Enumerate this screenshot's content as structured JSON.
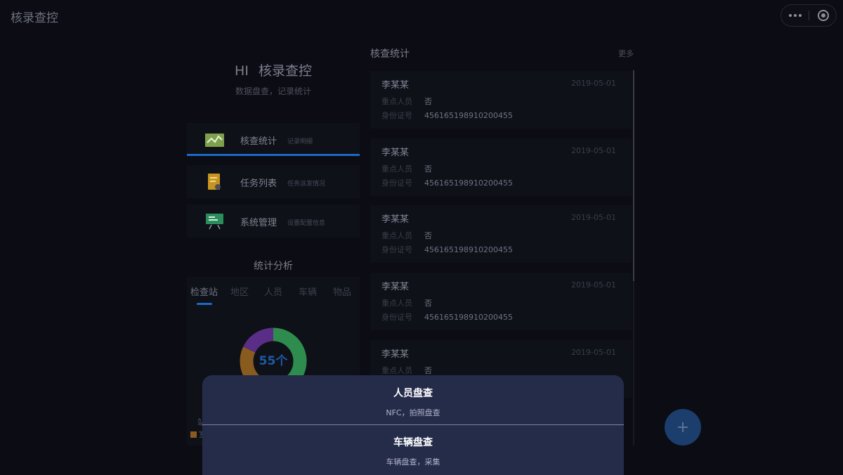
{
  "header": {
    "title": "核录查控"
  },
  "greeting": {
    "hi": "HI",
    "name": "核录查控",
    "subtitle": "数据盘查，记录统计"
  },
  "menu": [
    {
      "label": "核查统计",
      "desc": "记录明细",
      "icon": "chart-icon",
      "color": "#7ea04d"
    },
    {
      "label": "任务列表",
      "desc": "任务派发情况",
      "icon": "task-icon",
      "color": "#c7951f"
    },
    {
      "label": "系统管理",
      "desc": "设置配置信息",
      "icon": "board-icon",
      "color": "#2b8c5c"
    }
  ],
  "stats": {
    "title": "统计分析",
    "tabs": [
      "检查站",
      "地区",
      "人员",
      "车辆",
      "物品"
    ],
    "center_label": "55个",
    "legend_title": "站",
    "legend_first": "室"
  },
  "chart_data": {
    "type": "pie",
    "total_label": "55个",
    "slices": [
      {
        "color": "#2e8c4e",
        "fraction": 0.38
      },
      {
        "color": "#1b5aa8",
        "fraction": 0.1
      },
      {
        "color": "#8a5b1e",
        "fraction": 0.34
      },
      {
        "color": "#5a2d86",
        "fraction": 0.18
      }
    ]
  },
  "records": {
    "title": "核查统计",
    "more": "更多",
    "key_person_label": "重点人员",
    "id_label": "身份证号",
    "items": [
      {
        "name": "李某某",
        "date": "2019-05-01",
        "key_person": "否",
        "id_number": "456165198910200455"
      },
      {
        "name": "李某某",
        "date": "2019-05-01",
        "key_person": "否",
        "id_number": "456165198910200455"
      },
      {
        "name": "李某某",
        "date": "2019-05-01",
        "key_person": "否",
        "id_number": "456165198910200455"
      },
      {
        "name": "李某某",
        "date": "2019-05-01",
        "key_person": "否",
        "id_number": "456165198910200455"
      },
      {
        "name": "李某某",
        "date": "2019-05-01",
        "key_person": "否",
        "id_number": ""
      }
    ]
  },
  "sheet": {
    "options": [
      {
        "title": "人员盘查",
        "desc": "NFC，拍照盘查"
      },
      {
        "title": "车辆盘查",
        "desc": "车辆盘查，采集"
      }
    ]
  },
  "colors": {
    "accent": "#1b69c6",
    "sheet_bg": "#252c4a",
    "fab": "#1c3e6c"
  }
}
